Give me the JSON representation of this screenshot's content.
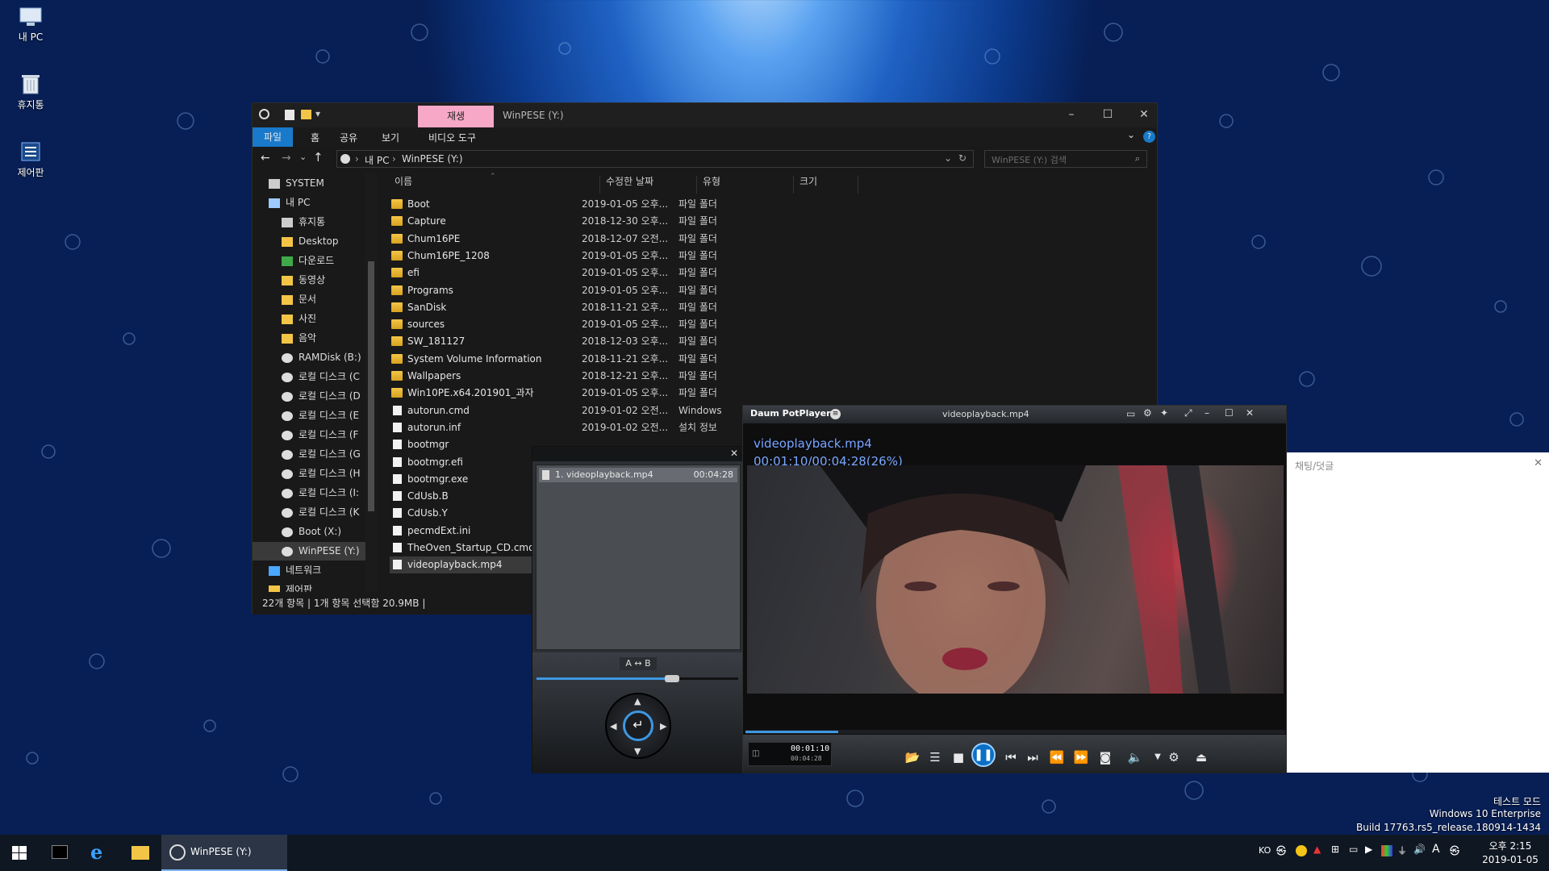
{
  "desktop": {
    "icons": [
      {
        "label": "내 PC"
      },
      {
        "label": "휴지통"
      },
      {
        "label": "제어판"
      }
    ],
    "watermark": {
      "line1": "테스트 모드",
      "line2": "Windows 10 Enterprise",
      "line3": "Build 17763.rs5_release.180914-1434"
    }
  },
  "explorer": {
    "context_tab": "재생",
    "title": "WinPESE (Y:)",
    "ribbon": {
      "file": "파일",
      "home": "홈",
      "share": "공유",
      "view": "보기",
      "video_tools": "비디오 도구"
    },
    "address": {
      "pc": "내 PC",
      "drive": "WinPESE (Y:)"
    },
    "search_placeholder": "WinPESE (Y:) 검색",
    "tree": [
      {
        "label": "SYSTEM"
      },
      {
        "label": "내 PC"
      },
      {
        "label": "휴지통"
      },
      {
        "label": "Desktop"
      },
      {
        "label": "다운로드"
      },
      {
        "label": "동영상"
      },
      {
        "label": "문서"
      },
      {
        "label": "사진"
      },
      {
        "label": "음악"
      },
      {
        "label": "RAMDisk (B:)"
      },
      {
        "label": "로컬 디스크 (C"
      },
      {
        "label": "로컬 디스크 (D"
      },
      {
        "label": "로컬 디스크 (E"
      },
      {
        "label": "로컬 디스크 (F"
      },
      {
        "label": "로컬 디스크 (G"
      },
      {
        "label": "로컬 디스크 (H"
      },
      {
        "label": "로컬 디스크 (I:"
      },
      {
        "label": "로컬 디스크 (K"
      },
      {
        "label": "Boot (X:)"
      },
      {
        "label": "WinPESE (Y:)"
      },
      {
        "label": "네트워크"
      },
      {
        "label": "제어판"
      }
    ],
    "columns": {
      "name": "이름",
      "date": "수정한 날짜",
      "type": "유형",
      "size": "크기"
    },
    "rows": [
      {
        "name": "Boot",
        "date": "2019-01-05 오후...",
        "type": "파일 폴더",
        "kind": "folder"
      },
      {
        "name": "Capture",
        "date": "2018-12-30 오후...",
        "type": "파일 폴더",
        "kind": "folder"
      },
      {
        "name": "Chum16PE",
        "date": "2018-12-07 오전...",
        "type": "파일 폴더",
        "kind": "folder"
      },
      {
        "name": "Chum16PE_1208",
        "date": "2019-01-05 오후...",
        "type": "파일 폴더",
        "kind": "folder"
      },
      {
        "name": "efi",
        "date": "2019-01-05 오후...",
        "type": "파일 폴더",
        "kind": "folder"
      },
      {
        "name": "Programs",
        "date": "2019-01-05 오후...",
        "type": "파일 폴더",
        "kind": "folder"
      },
      {
        "name": "SanDisk",
        "date": "2018-11-21 오후...",
        "type": "파일 폴더",
        "kind": "folder"
      },
      {
        "name": "sources",
        "date": "2019-01-05 오후...",
        "type": "파일 폴더",
        "kind": "folder"
      },
      {
        "name": "SW_181127",
        "date": "2018-12-03 오후...",
        "type": "파일 폴더",
        "kind": "folder"
      },
      {
        "name": "System Volume Information",
        "date": "2018-11-21 오후...",
        "type": "파일 폴더",
        "kind": "folder"
      },
      {
        "name": "Wallpapers",
        "date": "2018-12-21 오후...",
        "type": "파일 폴더",
        "kind": "folder"
      },
      {
        "name": "Win10PE.x64.201901_과자",
        "date": "2019-01-05 오후...",
        "type": "파일 폴더",
        "kind": "folder"
      },
      {
        "name": "autorun.cmd",
        "date": "2019-01-02 오전...",
        "type": "Windows",
        "kind": "file"
      },
      {
        "name": "autorun.inf",
        "date": "2019-01-02 오전...",
        "type": "설치 정보",
        "kind": "file"
      },
      {
        "name": "bootmgr",
        "date": "",
        "type": "",
        "kind": "file"
      },
      {
        "name": "bootmgr.efi",
        "date": "",
        "type": "",
        "kind": "file"
      },
      {
        "name": "bootmgr.exe",
        "date": "",
        "type": "",
        "kind": "file"
      },
      {
        "name": "CdUsb.B",
        "date": "",
        "type": "",
        "kind": "file"
      },
      {
        "name": "CdUsb.Y",
        "date": "",
        "type": "",
        "kind": "file"
      },
      {
        "name": "pecmdExt.ini",
        "date": "",
        "type": "",
        "kind": "file"
      },
      {
        "name": "TheOven_Startup_CD.cmd",
        "date": "",
        "type": "",
        "kind": "file"
      },
      {
        "name": "videoplayback.mp4",
        "date": "",
        "type": "",
        "kind": "file"
      }
    ],
    "status": "22개 항목  |  1개 항목 선택함 20.9MB  |"
  },
  "playlist": {
    "item": "1. videoplayback.mp4",
    "duration": "00:04:28",
    "ab": "A ↔ B",
    "volume_level": 0.67
  },
  "player": {
    "app": "Daum PotPlayer",
    "title": "videoplayback.mp4",
    "osd_name": "videoplayback.mp4",
    "osd_time": "00:01:10/00:04:28(26%)",
    "time_main": "00:01:10",
    "time_total": "00:04:28",
    "progress": 0.26
  },
  "chat": {
    "title": "채팅/덧글"
  },
  "taskbar": {
    "task_label": "WinPESE (Y:)",
    "lang": "KO",
    "time": "오후 2:15",
    "date": "2019-01-05"
  }
}
